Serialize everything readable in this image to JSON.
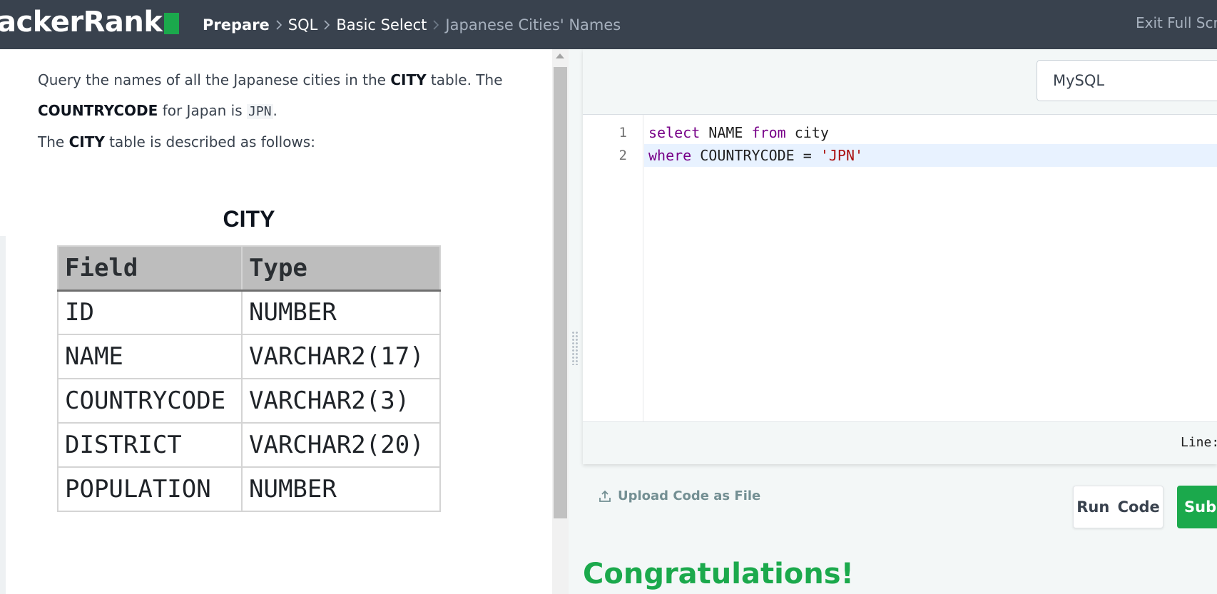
{
  "app": {
    "logo_text": "ackerRank",
    "accent_color": "#1ba94c",
    "nav_bg": "#39424e"
  },
  "breadcrumb": {
    "items": [
      "Prepare",
      "SQL",
      "Basic Select"
    ],
    "current": "Japanese Cities' Names",
    "separator_icon": "chevron-right-icon"
  },
  "header": {
    "exit_fullscreen": "Exit Full Scre"
  },
  "problem": {
    "line1_pre": "Query the names of all the Japanese cities in the ",
    "line1_bold": "CITY",
    "line1_post": " table. The",
    "line2_bold": "COUNTRYCODE",
    "line2_mid": " for Japan is ",
    "line2_code": "JPN",
    "line2_post": ".",
    "line3_pre": "The ",
    "line3_bold": "CITY",
    "line3_post": " table is described as follows:"
  },
  "schema_table": {
    "title": "CITY",
    "headers": [
      "Field",
      "Type"
    ],
    "rows": [
      [
        "ID",
        "NUMBER"
      ],
      [
        "NAME",
        "VARCHAR2(17)"
      ],
      [
        "COUNTRYCODE",
        "VARCHAR2(3)"
      ],
      [
        "DISTRICT",
        "VARCHAR2(20)"
      ],
      [
        "POPULATION",
        "NUMBER"
      ]
    ]
  },
  "editor": {
    "language": "MySQL",
    "line_numbers": [
      "1",
      "2"
    ],
    "line1": {
      "kw1": "select",
      "t1": " NAME ",
      "kw2": "from",
      "t2": " city"
    },
    "line2": {
      "kw1": "where",
      "t1": " COUNTRYCODE = ",
      "str": "'JPN'"
    },
    "status": "Line:"
  },
  "actions": {
    "upload_label": "Upload Code as File",
    "run_label": "Run Code",
    "submit_label": "Subm"
  },
  "result": {
    "message": "Congratulations!"
  }
}
